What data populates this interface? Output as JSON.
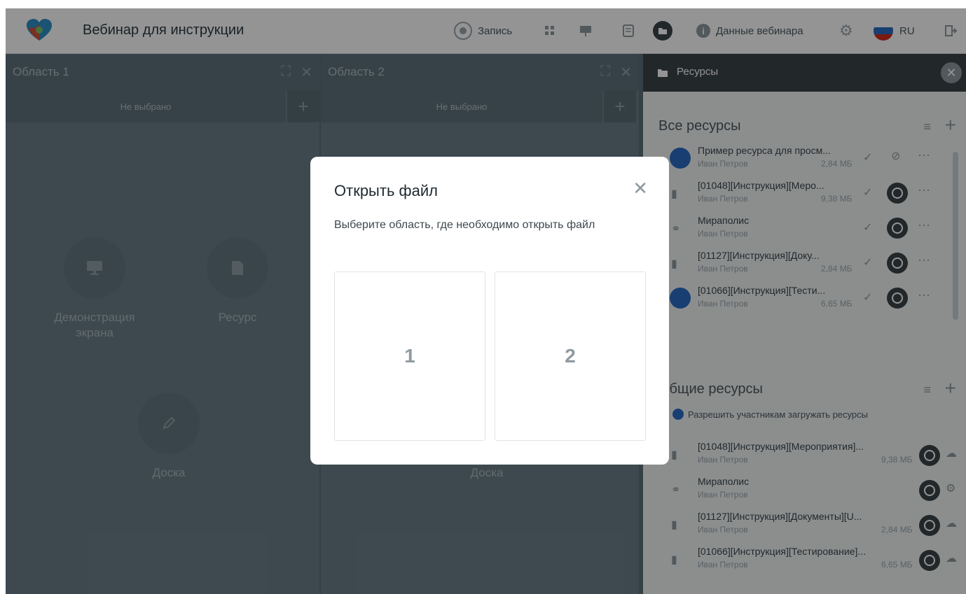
{
  "app": {
    "title": "Вебинар для инструкции"
  },
  "header": {
    "record_label": "Запись",
    "webinar_data_label": "Данные вебинара",
    "lang": "RU"
  },
  "areas": [
    {
      "title": "Область 1",
      "tab": "Не выбрано",
      "tools": [
        "Демонстрация экрана",
        "Ресурс",
        "Доска"
      ]
    },
    {
      "title": "Область 2",
      "tab": "Не выбрано",
      "tools": [
        "Доска"
      ]
    }
  ],
  "sidebar": {
    "title": "Ресурсы",
    "all_title": "Все ресурсы",
    "all_items": [
      {
        "name": "Пример ресурса для просм...",
        "author": "Иван Петров",
        "size": "2,84 МБ"
      },
      {
        "name": "[01048][Инструкция][Меро...",
        "author": "Иван Петров",
        "size": "9,38 МБ"
      },
      {
        "name": "Мираполис",
        "author": "Иван Петров",
        "size": ""
      },
      {
        "name": "[01127][Инструкция][Доку...",
        "author": "Иван Петров",
        "size": "2,84 МБ"
      },
      {
        "name": "[01066][Инструкция][Тести...",
        "author": "Иван Петров",
        "size": "6,65 МБ"
      }
    ],
    "shared_title": "Общие ресурсы",
    "allow_upload": "Разрешить участникам загружать ресурсы",
    "shared_items": [
      {
        "name": "[01048][Инструкция][Мероприятия]...",
        "author": "Иван Петров",
        "size": "9,38 МБ"
      },
      {
        "name": "Мираполис",
        "author": "Иван Петров",
        "size": ""
      },
      {
        "name": "[01127][Инструкция][Документы][U...",
        "author": "Иван Петров",
        "size": "2,84 МБ"
      },
      {
        "name": "[01066][Инструкция][Тестирование]...",
        "author": "Иван Петров",
        "size": "6,65 МБ"
      }
    ]
  },
  "modal": {
    "title": "Открыть файл",
    "description": "Выберите область, где необходимо открыть файл",
    "options": [
      "1",
      "2"
    ]
  },
  "colors": {
    "accent_blue": "#2b6cc4",
    "dark": "#3b4449",
    "flag_red": "#d52b1e"
  }
}
